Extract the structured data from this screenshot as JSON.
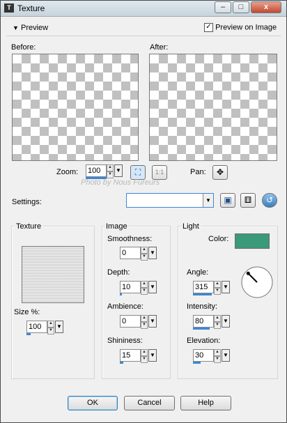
{
  "window": {
    "title": "Texture",
    "controls": {
      "minimize": "–",
      "maximize": "□",
      "close": "x"
    }
  },
  "preview": {
    "section_label": "Preview",
    "preview_on_image_label": "Preview on Image",
    "preview_on_image_checked": true,
    "before_label": "Before:",
    "after_label": "After:",
    "zoom_label": "Zoom:",
    "zoom_value": "100",
    "one_to_one_label": "1:1",
    "pan_label": "Pan:"
  },
  "settings": {
    "label": "Settings:",
    "preset_value": ""
  },
  "watermark": {
    "text": "Photo by Nous Fureurs"
  },
  "texture": {
    "group_label": "Texture",
    "size_label": "Size %:",
    "size_value": "100",
    "size_fill": 0.2
  },
  "image": {
    "group_label": "Image",
    "smoothness_label": "Smoothness:",
    "smoothness_value": "0",
    "smoothness_fill": 0.0,
    "depth_label": "Depth:",
    "depth_value": "10",
    "depth_fill": 0.1,
    "ambience_label": "Ambience:",
    "ambience_value": "0",
    "ambience_fill": 0.0,
    "shininess_label": "Shininess:",
    "shininess_value": "15",
    "shininess_fill": 0.15
  },
  "light": {
    "group_label": "Light",
    "color_label": "Color:",
    "color_value": "#3a9a7a",
    "angle_label": "Angle:",
    "angle_value": "315",
    "angle_fill": 0.9,
    "intensity_label": "Intensity:",
    "intensity_value": "80",
    "intensity_fill": 0.8,
    "elevation_label": "Elevation:",
    "elevation_value": "30",
    "elevation_fill": 0.35
  },
  "buttons": {
    "ok": "OK",
    "cancel": "Cancel",
    "help": "Help"
  }
}
